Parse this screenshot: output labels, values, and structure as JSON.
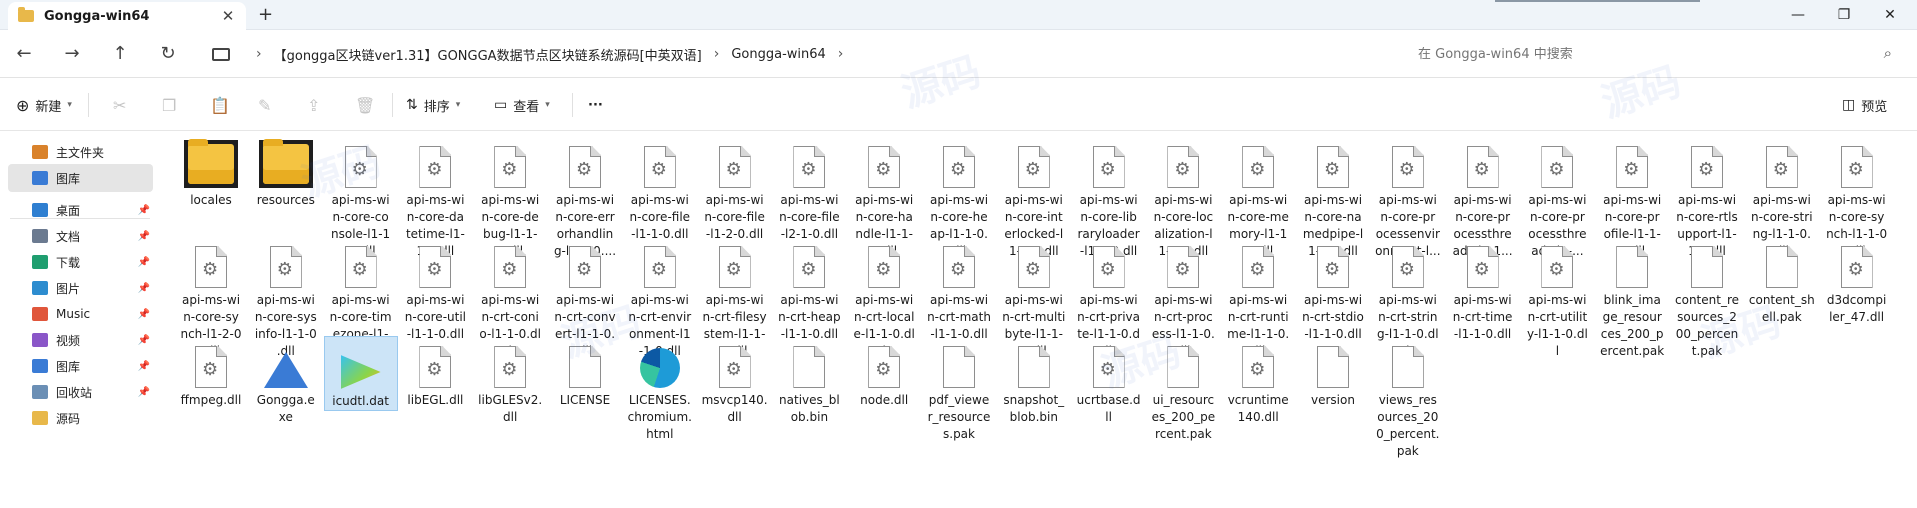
{
  "window": {
    "tab_title": "Gongga-win64",
    "tab_close": "✕",
    "new_tab": "+",
    "minimize": "—",
    "maximize": "❐",
    "close": "✕"
  },
  "nav": {
    "back": "←",
    "forward": "→",
    "up": "↑",
    "refresh": "↻"
  },
  "breadcrumb": {
    "items": [
      "【gongga区块链ver1.31】GONGGA数据节点区块链系统源码[中英双语]",
      "Gongga-win64"
    ],
    "separator": "›"
  },
  "search": {
    "placeholder": "在 Gongga-win64 中搜索"
  },
  "toolbar": {
    "new_label": "新建",
    "sort_label": "排序",
    "view_label": "查看",
    "more_label": "···",
    "preview_label": "预览"
  },
  "sidebar": {
    "items": [
      {
        "label": "主文件夹",
        "icon": "home-icon",
        "color": "#d9822b"
      },
      {
        "label": "图库",
        "icon": "gallery-icon",
        "color": "#3a7bd5"
      },
      {
        "label": "桌面",
        "icon": "desktop-icon",
        "color": "#2f7fd1"
      },
      {
        "label": "文档",
        "icon": "documents-icon",
        "color": "#6b7a90"
      },
      {
        "label": "下载",
        "icon": "downloads-icon",
        "color": "#1f9e6f"
      },
      {
        "label": "图片",
        "icon": "pictures-icon",
        "color": "#2d8ccf"
      },
      {
        "label": "Music",
        "icon": "music-icon",
        "color": "#e0563b"
      },
      {
        "label": "视频",
        "icon": "videos-icon",
        "color": "#8a56c8"
      },
      {
        "label": "图库",
        "icon": "gallery-icon",
        "color": "#3a7bd5"
      },
      {
        "label": "回收站",
        "icon": "recycle-bin-icon",
        "color": "#6b8fb5"
      },
      {
        "label": "源码",
        "icon": "folder-icon",
        "color": "#e8b84a"
      }
    ]
  },
  "files": [
    {
      "name": "locales",
      "type": "folder"
    },
    {
      "name": "resources",
      "type": "folder"
    },
    {
      "name": "api-ms-win-core-console-l1-1-0.dll",
      "type": "dll",
      "display": "api-ms-wi\nn-core-co\nnsole-l1-1\n-0.dll"
    },
    {
      "name": "api-ms-win-core-datetime-l1-1-0.dll",
      "type": "dll",
      "display": "api-ms-wi\nn-core-da\ntetime-l1-\n1-0.dll"
    },
    {
      "name": "api-ms-win-core-debug-l1-1-0.dll",
      "type": "dll",
      "display": "api-ms-wi\nn-core-de\nbug-l1-1-\n0.dll"
    },
    {
      "name": "api-ms-win-core-errorhandling-l1-1-0.dll",
      "type": "dll",
      "display": "api-ms-wi\nn-core-err\norhandlin\ng-l1-1-0...."
    },
    {
      "name": "api-ms-win-core-file-l1-1-0.dll",
      "type": "dll",
      "display": "api-ms-wi\nn-core-file\n-l1-1-0.dll"
    },
    {
      "name": "api-ms-win-core-file-l1-2-0.dll",
      "type": "dll",
      "display": "api-ms-wi\nn-core-file\n-l1-2-0.dll"
    },
    {
      "name": "api-ms-win-core-file-l2-1-0.dll",
      "type": "dll",
      "display": "api-ms-wi\nn-core-file\n-l2-1-0.dll"
    },
    {
      "name": "api-ms-win-core-handle-l1-1-0.dll",
      "type": "dll",
      "display": "api-ms-wi\nn-core-ha\nndle-l1-1-\n0.dll"
    },
    {
      "name": "api-ms-win-core-heap-l1-1-0.dll",
      "type": "dll",
      "display": "api-ms-wi\nn-core-he\nap-l1-1-0.\ndll"
    },
    {
      "name": "api-ms-win-core-interlocked-l1-1-0.dll",
      "type": "dll",
      "display": "api-ms-wi\nn-core-int\nerlocked-l\n1-1-0.dll"
    },
    {
      "name": "api-ms-win-core-libraryloader-l1-1-0.dll",
      "type": "dll",
      "display": "api-ms-wi\nn-core-lib\nraryloader\n-l1-1-0.dll"
    },
    {
      "name": "api-ms-win-core-localization-l1-2-0.dll",
      "type": "dll",
      "display": "api-ms-wi\nn-core-loc\nalization-l\n1-2-0.dll"
    },
    {
      "name": "api-ms-win-core-memory-l1-1-0.dll",
      "type": "dll",
      "display": "api-ms-wi\nn-core-me\nmory-l1-1\n-0.dll"
    },
    {
      "name": "api-ms-win-core-namedpipe-l1-1-0.dll",
      "type": "dll",
      "display": "api-ms-wi\nn-core-na\nmedpipe-l\n1-1-0.dll"
    },
    {
      "name": "api-ms-win-core-processenvironment-l...",
      "type": "dll",
      "display": "api-ms-wi\nn-core-pr\nocessenvir\nonment-l..."
    },
    {
      "name": "api-ms-win-core-processthreads-l1-1...",
      "type": "dll",
      "display": "api-ms-wi\nn-core-pr\nocessthre\nads-l1-1..."
    },
    {
      "name": "api-ms-win-core-processthreads-l1...",
      "type": "dll",
      "display": "api-ms-wi\nn-core-pr\nocessthre\nads-l1-..."
    },
    {
      "name": "api-ms-win-core-profile-l1-1-0.dll",
      "type": "dll",
      "display": "api-ms-wi\nn-core-pr\nofile-l1-1-\n0.dll"
    },
    {
      "name": "api-ms-win-core-rtlsupport-l1-1-0.dll",
      "type": "dll",
      "display": "api-ms-wi\nn-core-rtls\nupport-l1-\n1-0.dll"
    },
    {
      "name": "api-ms-win-core-string-l1-1-0.dll",
      "type": "dll",
      "display": "api-ms-wi\nn-core-stri\nng-l1-1-0.\ndll"
    },
    {
      "name": "api-ms-win-core-synch-l1-1-0.dll",
      "type": "dll",
      "display": "api-ms-wi\nn-core-sy\nnch-l1-1-0\n.dll"
    },
    {
      "name": "api-ms-win-core-synch-l1-2-0.dll",
      "type": "dll",
      "display": "api-ms-wi\nn-core-sy\nnch-l1-2-0\n.dll"
    },
    {
      "name": "api-ms-win-core-sysinfo-l1-1-0.dll",
      "type": "dll",
      "display": "api-ms-wi\nn-core-sys\ninfo-l1-1-0\n.dll"
    },
    {
      "name": "api-ms-win-core-timezone-l1-1-0.dll",
      "type": "dll",
      "display": "api-ms-wi\nn-core-tim\nezone-l1-\n1-0.dll"
    },
    {
      "name": "api-ms-win-core-util-l1-1-0.dll",
      "type": "dll",
      "display": "api-ms-wi\nn-core-util\n-l1-1-0.dll"
    },
    {
      "name": "api-ms-win-crt-conio-l1-1-0.dll",
      "type": "dll",
      "display": "api-ms-wi\nn-crt-coni\no-l1-1-0.dl\nl"
    },
    {
      "name": "api-ms-win-crt-convert-l1-1-0.dll",
      "type": "dll",
      "display": "api-ms-wi\nn-crt-conv\nert-l1-1-0.\ndll"
    },
    {
      "name": "api-ms-win-crt-environment-l1-1-0.dll",
      "type": "dll",
      "display": "api-ms-wi\nn-crt-envir\nonment-l1\n-1-0.dll"
    },
    {
      "name": "api-ms-win-crt-filesystem-l1-1-0.dll",
      "type": "dll",
      "display": "api-ms-wi\nn-crt-filesy\nstem-l1-1-\n0.dll"
    },
    {
      "name": "api-ms-win-crt-heap-l1-1-0.dll",
      "type": "dll",
      "display": "api-ms-wi\nn-crt-heap\n-l1-1-0.dll"
    },
    {
      "name": "api-ms-win-crt-locale-l1-1-0.dll",
      "type": "dll",
      "display": "api-ms-wi\nn-crt-local\ne-l1-1-0.dl\nl"
    },
    {
      "name": "api-ms-win-crt-math-l1-1-0.dll",
      "type": "dll",
      "display": "api-ms-wi\nn-crt-math\n-l1-1-0.dll"
    },
    {
      "name": "api-ms-win-crt-multibyte-l1-1-0.dll",
      "type": "dll",
      "display": "api-ms-wi\nn-crt-multi\nbyte-l1-1-\n0.dll"
    },
    {
      "name": "api-ms-win-crt-private-l1-1-0.dll",
      "type": "dll",
      "display": "api-ms-wi\nn-crt-priva\nte-l1-1-0.d\nll"
    },
    {
      "name": "api-ms-win-crt-process-l1-1-0.dll",
      "type": "dll",
      "display": "api-ms-wi\nn-crt-proc\ness-l1-1-0.\ndll"
    },
    {
      "name": "api-ms-win-crt-runtime-l1-1-0.dll",
      "type": "dll",
      "display": "api-ms-wi\nn-crt-runti\nme-l1-1-0.\ndll"
    },
    {
      "name": "api-ms-win-crt-stdio-l1-1-0.dll",
      "type": "dll",
      "display": "api-ms-wi\nn-crt-stdio\n-l1-1-0.dll"
    },
    {
      "name": "api-ms-win-crt-string-l1-1-0.dll",
      "type": "dll",
      "display": "api-ms-wi\nn-crt-strin\ng-l1-1-0.dl\nl"
    },
    {
      "name": "api-ms-win-crt-time-l1-1-0.dll",
      "type": "dll",
      "display": "api-ms-wi\nn-crt-time\n-l1-1-0.dll"
    },
    {
      "name": "api-ms-win-crt-utility-l1-1-0.dll",
      "type": "dll",
      "display": "api-ms-wi\nn-crt-utilit\ny-l1-1-0.dl\nl"
    },
    {
      "name": "blink_image_resources_200_percent.pak",
      "type": "doc",
      "display": "blink_ima\nge_resour\nces_200_p\nercent.pak"
    },
    {
      "name": "content_resources_200_percent.pak",
      "type": "doc",
      "display": "content_re\nsources_2\n00_percen\nt.pak"
    },
    {
      "name": "content_shell.pak",
      "type": "doc",
      "display": "content_sh\nell.pak"
    },
    {
      "name": "d3dcompiler_47.dll",
      "type": "dll",
      "display": "d3dcompi\nler_47.dll"
    },
    {
      "name": "ffmpeg.dll",
      "type": "dll",
      "display": "ffmpeg.dll"
    },
    {
      "name": "Gongga.exe",
      "type": "exe",
      "display": "Gongga.e\nxe"
    },
    {
      "name": "icudtl.dat",
      "type": "vcp",
      "display": "icudtl.dat"
    },
    {
      "name": "libEGL.dll",
      "type": "dll",
      "display": "libEGL.dll"
    },
    {
      "name": "libGLESv2.dll",
      "type": "dll",
      "display": "libGLESv2.\ndll"
    },
    {
      "name": "LICENSE",
      "type": "doc",
      "display": "LICENSE"
    },
    {
      "name": "LICENSES.chromium.html",
      "type": "edge",
      "display": "LICENSES.\nchromium.\nhtml"
    },
    {
      "name": "msvcp140.dll",
      "type": "dll",
      "display": "msvcp140.\ndll"
    },
    {
      "name": "natives_blob.bin",
      "type": "doc",
      "display": "natives_bl\nob.bin"
    },
    {
      "name": "node.dll",
      "type": "dll",
      "display": "node.dll"
    },
    {
      "name": "pdf_viewer_resources.pak",
      "type": "doc",
      "display": "pdf_viewe\nr_resource\ns.pak"
    },
    {
      "name": "snapshot_blob.bin",
      "type": "doc",
      "display": "snapshot_\nblob.bin"
    },
    {
      "name": "ucrtbase.dll",
      "type": "dll",
      "display": "ucrtbase.d\nll"
    },
    {
      "name": "ui_resources_200_percent.pak",
      "type": "doc",
      "display": "ui_resourc\nes_200_pe\nrcent.pak"
    },
    {
      "name": "vcruntime140.dll",
      "type": "dll",
      "display": "vcruntime\n140.dll"
    },
    {
      "name": "version",
      "type": "doc",
      "display": "version"
    },
    {
      "name": "views_resources_200_percent.pak",
      "type": "doc",
      "display": "views_res\nources_20\n0_percent.\npak"
    }
  ],
  "watermark": "源码"
}
